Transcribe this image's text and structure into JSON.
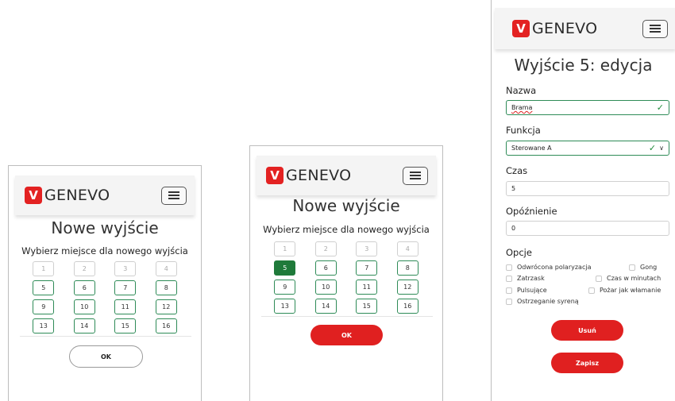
{
  "brand": {
    "name": "GENEVO",
    "mark": "V"
  },
  "screen1": {
    "title": "Nowe wyjście",
    "subtitle": "Wybierz miejsce dla nowego wyjścia",
    "slots": [
      {
        "n": "1",
        "state": "disabled"
      },
      {
        "n": "2",
        "state": "disabled"
      },
      {
        "n": "3",
        "state": "disabled"
      },
      {
        "n": "4",
        "state": "disabled"
      },
      {
        "n": "5",
        "state": "available"
      },
      {
        "n": "6",
        "state": "available"
      },
      {
        "n": "7",
        "state": "available"
      },
      {
        "n": "8",
        "state": "available"
      },
      {
        "n": "9",
        "state": "available"
      },
      {
        "n": "10",
        "state": "available"
      },
      {
        "n": "11",
        "state": "available"
      },
      {
        "n": "12",
        "state": "available"
      },
      {
        "n": "13",
        "state": "available"
      },
      {
        "n": "14",
        "state": "available"
      },
      {
        "n": "15",
        "state": "available"
      },
      {
        "n": "16",
        "state": "available"
      }
    ],
    "ok_label": "OK"
  },
  "screen2": {
    "title": "Nowe wyjście",
    "subtitle": "Wybierz miejsce dla nowego wyjścia",
    "slots": [
      {
        "n": "1",
        "state": "disabled"
      },
      {
        "n": "2",
        "state": "disabled"
      },
      {
        "n": "3",
        "state": "disabled"
      },
      {
        "n": "4",
        "state": "disabled"
      },
      {
        "n": "5",
        "state": "selected"
      },
      {
        "n": "6",
        "state": "available"
      },
      {
        "n": "7",
        "state": "available"
      },
      {
        "n": "8",
        "state": "available"
      },
      {
        "n": "9",
        "state": "available"
      },
      {
        "n": "10",
        "state": "available"
      },
      {
        "n": "11",
        "state": "available"
      },
      {
        "n": "12",
        "state": "available"
      },
      {
        "n": "13",
        "state": "available"
      },
      {
        "n": "14",
        "state": "available"
      },
      {
        "n": "15",
        "state": "available"
      },
      {
        "n": "16",
        "state": "available"
      }
    ],
    "ok_label": "OK"
  },
  "screen3": {
    "title": "Wyjście 5: edycja",
    "name_label": "Nazwa",
    "name_value": "Brama",
    "function_label": "Funkcja",
    "function_value": "Sterowane A",
    "time_label": "Czas",
    "time_value": "5",
    "delay_label": "Opóźnienie",
    "delay_value": "0",
    "options_label": "Opcje",
    "options": {
      "inverted_polarity": "Odwrócona polaryzacja",
      "gong": "Gong",
      "latch": "Zatrzask",
      "time_in_minutes": "Czas w minutach",
      "pulsing": "Pulsujące",
      "fire_as_burglary": "Pożar jak włamanie",
      "siren_warning": "Ostrzeganie syreną"
    },
    "delete_label": "Usuń",
    "save_label": "Zapisz"
  },
  "colors": {
    "accent_red": "#e02020",
    "valid_green": "#1f7a3a",
    "header_bg": "#f4f4f4"
  }
}
